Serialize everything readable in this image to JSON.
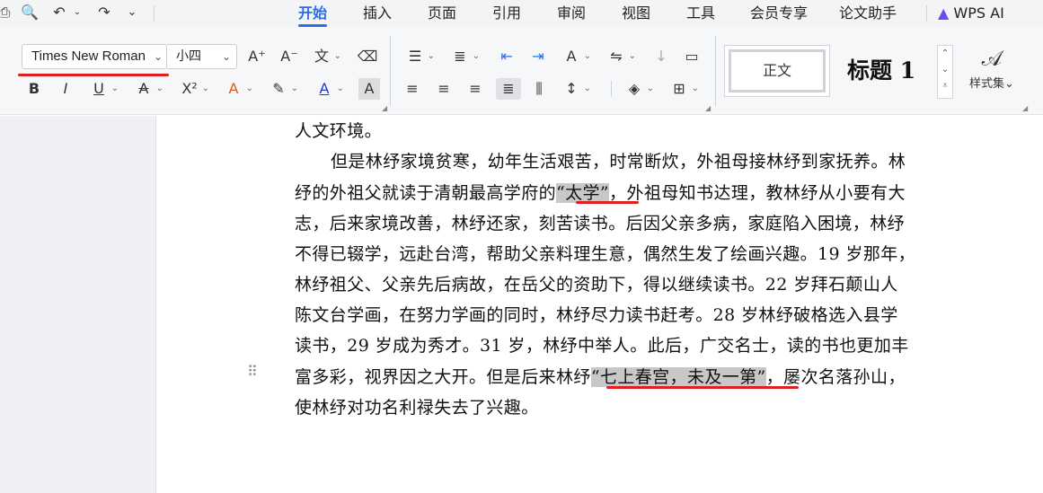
{
  "menu": {
    "tabs": [
      "开始",
      "插入",
      "页面",
      "引用",
      "审阅",
      "视图",
      "工具",
      "会员专享",
      "论文助手"
    ],
    "active_tab": "开始",
    "ai_label": "WPS AI"
  },
  "font": {
    "family": "Times New Roman",
    "size": "小四"
  },
  "styles": {
    "normal": "正文",
    "heading": "标题 1",
    "gallery_label": "样式集"
  },
  "document": {
    "lines": [
      "人文环境。",
      "但是林纾家境贫寒，幼年生活艰苦，时常断炊，外祖母接林纾到家抚养。林",
      "纾的外祖父就读于清朝最高学府的“太学”，外祖母知书达理，教林纾从小要有大",
      "志，后来家境改善，林纾还家，刻苦读书。后因父亲多病，家庭陷入困境，林纾",
      "不得已辍学，远赴台湾，帮助父亲料理生意，偶然生发了绘画兴趣。19 岁那年，",
      "林纾祖父、父亲先后病故，在岳父的资助下，得以继续读书。22 岁拜石颠山人",
      "陈文台学画，在努力学画的同时，林纾尽力读书赶考。28 岁林纾破格选入县学",
      "读书，29 岁成为秀才。31 岁，林纾中举人。此后，广交名士，读的书也更加丰",
      "富多彩，视界因之大开。但是后来林纾“七上春宫，未及一第”，屡次名落孙山，",
      "使林纾对功名利禄失去了兴趣。"
    ],
    "line2_before": "纾的外祖父就读于清朝最高学府的",
    "line2_quote": "“太学”",
    "line2_after": "，外祖母知书达理，教林纾从小要有大",
    "line8_before": "富多彩，视界因之大开。但是后来林纾",
    "line8_quote": "“七上春宫，未及一第”",
    "line8_after": "，屡次名落孙山，"
  },
  "colors": {
    "accent": "#2b6de8",
    "annotation": "#e02020",
    "highlight": "#c8c8c8"
  }
}
